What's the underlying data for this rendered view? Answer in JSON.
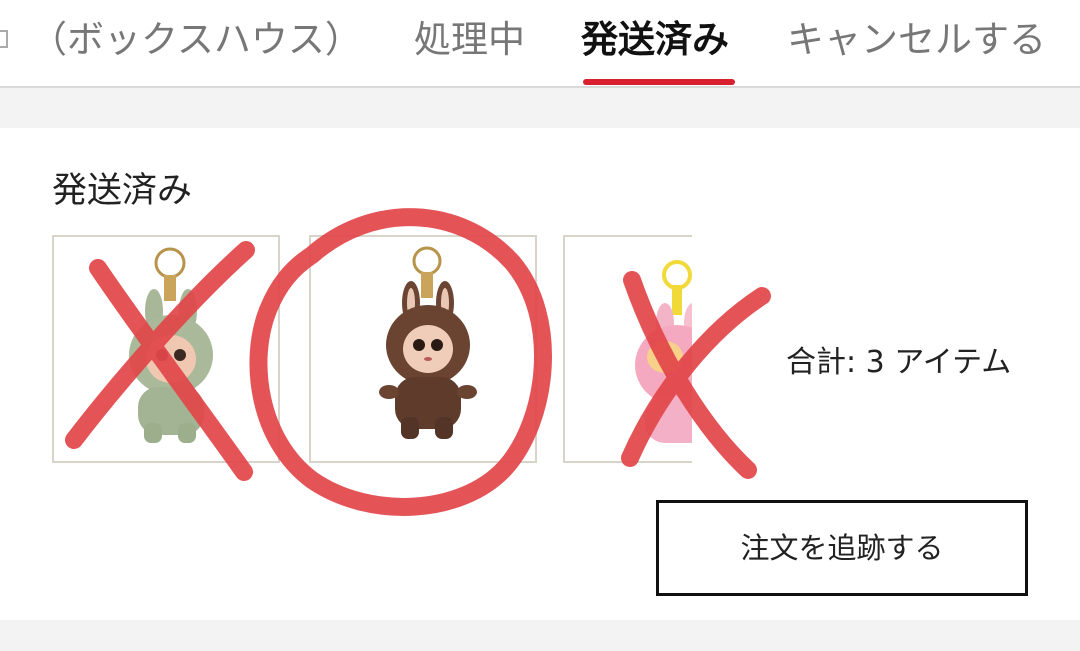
{
  "tabs": [
    {
      "label": "（ボックスハウス）",
      "active": false
    },
    {
      "label": "処理中",
      "active": false
    },
    {
      "label": "発送済み",
      "active": true
    },
    {
      "label": "キャンセルする",
      "active": false
    }
  ],
  "colors": {
    "accent": "#d8202e",
    "annotation": "#e2474a",
    "thumb_border": "#d8d4c9"
  },
  "order": {
    "status_title": "発送済み",
    "items": [
      {
        "product": "green plush bunny keychain",
        "annotation": "cross"
      },
      {
        "product": "brown plush bunny keychain",
        "annotation": "circle"
      },
      {
        "product": "pink plush bunny keychain",
        "annotation": "cross"
      }
    ],
    "total": "合計: 3 アイテム",
    "track_button": "注文を追跡する"
  }
}
